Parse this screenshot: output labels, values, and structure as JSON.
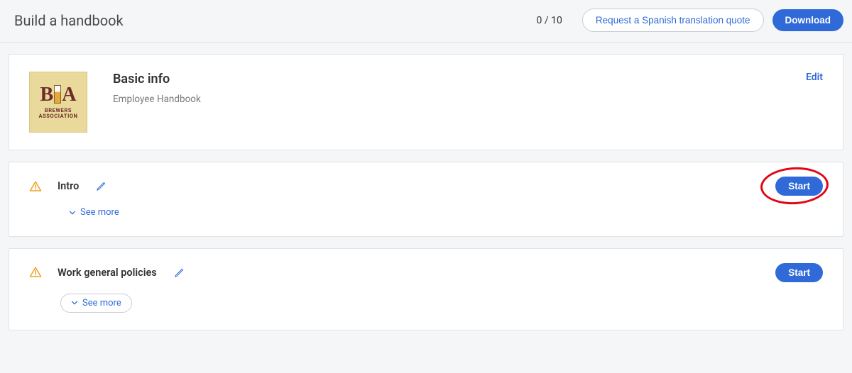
{
  "header": {
    "title": "Build a handbook",
    "progress": "0 / 10",
    "translation_quote_label": "Request a Spanish translation quote",
    "download_label": "Download"
  },
  "basic": {
    "title": "Basic info",
    "subtitle": "Employee Handbook",
    "edit_label": "Edit",
    "logo": {
      "letters_left": "B",
      "letters_right": "A",
      "sub_line1": "BREWERS",
      "sub_line2": "ASSOCIATION"
    }
  },
  "sections": [
    {
      "title": "Intro",
      "see_more_label": "See more",
      "start_label": "Start",
      "highlighted": true,
      "see_more_outlined": false
    },
    {
      "title": "Work general policies",
      "see_more_label": "See more",
      "start_label": "Start",
      "highlighted": false,
      "see_more_outlined": true
    }
  ]
}
